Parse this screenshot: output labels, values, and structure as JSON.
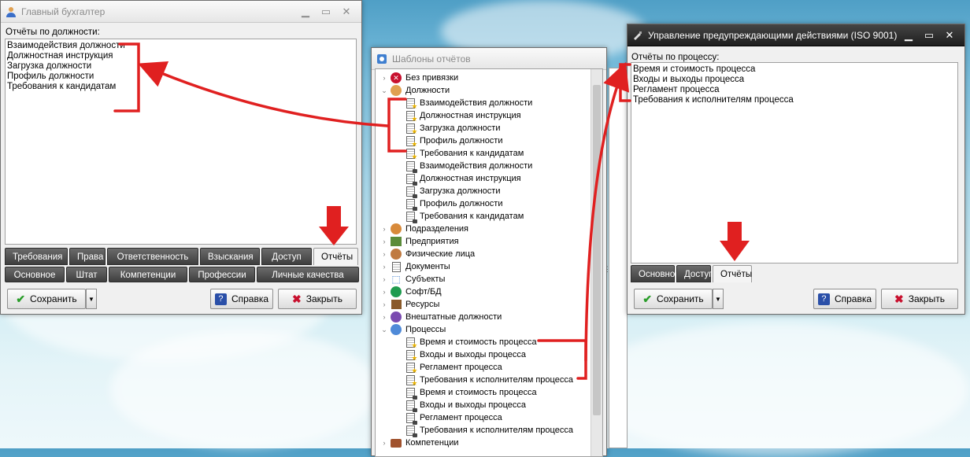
{
  "window1": {
    "title": "Главный бухгалтер",
    "caption": "Отчёты по должности:",
    "items": [
      "Взаимодействия должности",
      "Должностная инструкция",
      "Загрузка должности",
      "Профиль должности",
      "Требования к кандидатам"
    ],
    "tabs_top": [
      "Требования",
      "Права",
      "Ответственность",
      "Взыскания",
      "Доступ",
      "Отчёты"
    ],
    "tabs_bottom": [
      "Основное",
      "Штат",
      "Компетенции",
      "Профессии",
      "Личные качества"
    ],
    "save": "Сохранить",
    "help": "Справка",
    "close": "Закрыть"
  },
  "window2": {
    "title": "Шаблоны отчётов",
    "tree": [
      {
        "label": "Без привязки",
        "icon": "no-binding-icon"
      },
      {
        "label": "Должности",
        "icon": "positions-icon"
      },
      {
        "label": "Взаимодействия должности",
        "icon": "report-template-icon"
      },
      {
        "label": "Должностная инструкция",
        "icon": "report-template-icon"
      },
      {
        "label": "Загрузка должности",
        "icon": "report-template-icon"
      },
      {
        "label": "Профиль должности",
        "icon": "report-template-icon"
      },
      {
        "label": "Требования к кандидатам",
        "icon": "report-template-icon"
      },
      {
        "label": "Взаимодействия должности",
        "icon": "locked-report-icon"
      },
      {
        "label": "Должностная инструкция",
        "icon": "locked-report-icon"
      },
      {
        "label": "Загрузка должности",
        "icon": "locked-report-icon"
      },
      {
        "label": "Профиль должности",
        "icon": "locked-report-icon"
      },
      {
        "label": "Требования к кандидатам",
        "icon": "locked-report-icon"
      },
      {
        "label": "Подразделения",
        "icon": "departments-icon"
      },
      {
        "label": "Предприятия",
        "icon": "enterprises-icon"
      },
      {
        "label": "Физические лица",
        "icon": "persons-icon"
      },
      {
        "label": "Документы",
        "icon": "documents-icon"
      },
      {
        "label": "Субъекты",
        "icon": "subjects-icon"
      },
      {
        "label": "Софт/БД",
        "icon": "software-icon"
      },
      {
        "label": "Ресурсы",
        "icon": "resources-icon"
      },
      {
        "label": "Внештатные должности",
        "icon": "freelance-icon"
      },
      {
        "label": "Процессы",
        "icon": "processes-icon"
      },
      {
        "label": "Время и стоимость процесса",
        "icon": "report-template-icon"
      },
      {
        "label": "Входы и выходы процесса",
        "icon": "report-template-icon"
      },
      {
        "label": "Регламент процесса",
        "icon": "report-template-icon"
      },
      {
        "label": "Требования к исполнителям процесса",
        "icon": "report-template-icon"
      },
      {
        "label": "Время и стоимость процесса",
        "icon": "locked-report-icon"
      },
      {
        "label": "Входы и выходы процесса",
        "icon": "locked-report-icon"
      },
      {
        "label": "Регламент процесса",
        "icon": "locked-report-icon"
      },
      {
        "label": "Требования к исполнителям процесса",
        "icon": "locked-report-icon"
      },
      {
        "label": "Компетенции",
        "icon": "competencies-icon"
      }
    ]
  },
  "window3": {
    "title": "Управление предупреждающими действиями (ISO 9001)",
    "caption": "Отчёты по процессу:",
    "items": [
      "Время и стоимость процесса",
      "Входы и выходы процесса",
      "Регламент процесса",
      "Требования к исполнителям процесса"
    ],
    "tabs": [
      "Основное",
      "Доступ",
      "Отчёты"
    ],
    "save": "Сохранить",
    "help": "Справка",
    "close": "Закрыть"
  },
  "colors": {
    "annotation": "#e02020",
    "dark_tab": "#4a4a4a"
  }
}
